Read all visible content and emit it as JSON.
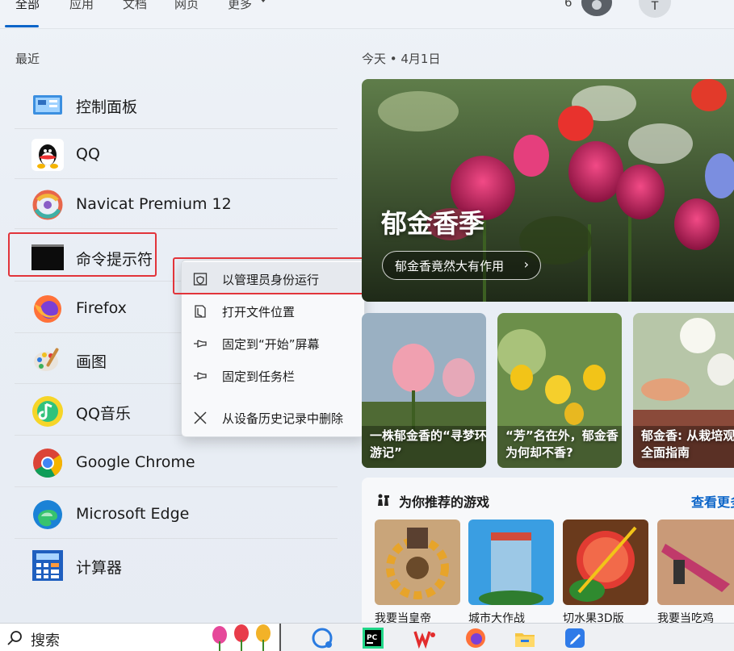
{
  "tabs": [
    "全部",
    "应用",
    "文档",
    "网页",
    "更多"
  ],
  "header": {
    "count": "6",
    "avatar_letter": "T",
    "more": "···"
  },
  "recent_label": "最近",
  "apps": [
    {
      "name": "控制面板",
      "icon": "control-panel-icon"
    },
    {
      "name": "QQ",
      "icon": "qq-icon"
    },
    {
      "name": "Navicat Premium 12",
      "icon": "navicat-icon"
    },
    {
      "name": "命令提示符",
      "icon": "cmd-icon"
    },
    {
      "name": "Firefox",
      "icon": "firefox-icon"
    },
    {
      "name": "画图",
      "icon": "paint-icon"
    },
    {
      "name": "QQ音乐",
      "icon": "qq-music-icon"
    },
    {
      "name": "Google Chrome",
      "icon": "chrome-icon"
    },
    {
      "name": "Microsoft Edge",
      "icon": "edge-icon"
    },
    {
      "name": "计算器",
      "icon": "calculator-icon"
    }
  ],
  "context_menu": [
    {
      "label": "以管理员身份运行",
      "icon": "shield-icon",
      "selected": true
    },
    {
      "label": "打开文件位置",
      "icon": "folder-icon"
    },
    {
      "label": "固定到“开始”屏幕",
      "icon": "pin-icon"
    },
    {
      "label": "固定到任务栏",
      "icon": "pin-icon"
    },
    {
      "label": "从设备历史记录中删除",
      "icon": "close-icon"
    }
  ],
  "today": {
    "date": "今天 • 4月1日",
    "hero_title": "郁金香季",
    "hero_button": "郁金香竟然大有作用",
    "cards": [
      {
        "text": "一株郁金香的“寻梦环游记”"
      },
      {
        "text": "“芳”名在外，郁金香为何却不香?"
      },
      {
        "text": "郁金香: 从栽培观赏的全面指南"
      }
    ]
  },
  "games": {
    "title": "为你推荐的游戏",
    "see_more": "查看更多",
    "items": [
      {
        "name": "我要当皇帝"
      },
      {
        "name": "城市大作战"
      },
      {
        "name": "切水果3D版"
      },
      {
        "name": "我要当吃鸡"
      }
    ]
  },
  "taskbar": {
    "search_label": "搜索"
  },
  "colors": {
    "accent": "#0a64c8",
    "highlight": "#e2343a"
  }
}
